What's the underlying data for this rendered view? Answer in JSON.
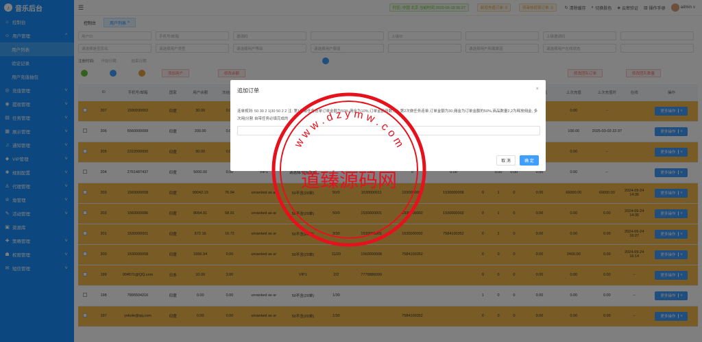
{
  "app": {
    "title": "音乐后台"
  },
  "sidebar": {
    "items": [
      {
        "label": "控制台",
        "icon": "home-icon"
      },
      {
        "label": "用户管理",
        "icon": "user-icon"
      },
      {
        "label": "充值管理",
        "icon": "recharge-icon"
      },
      {
        "label": "提现管理",
        "icon": "withdraw-icon"
      },
      {
        "label": "任务管理",
        "icon": "task-icon"
      },
      {
        "label": "展示管理",
        "icon": "display-icon"
      },
      {
        "label": "通知管理",
        "icon": "bell-icon"
      },
      {
        "label": "VIP管理",
        "icon": "vip-icon"
      },
      {
        "label": "规则配置",
        "icon": "gear-icon"
      },
      {
        "label": "代理管理",
        "icon": "agent-icon"
      },
      {
        "label": "角管理",
        "icon": "role-icon"
      },
      {
        "label": "活动管理",
        "icon": "activity-icon"
      },
      {
        "label": "资源库",
        "icon": "folder-icon"
      },
      {
        "label": "策略管理",
        "icon": "strategy-icon"
      },
      {
        "label": "权限管理",
        "icon": "lock-icon"
      },
      {
        "label": "短信管理",
        "icon": "sms-icon"
      }
    ],
    "subitems": [
      "用户列表",
      "验证记录",
      "用户充值抽包"
    ]
  },
  "header": {
    "status_time": "时区: 中国 北京 当前时间 2025-06-18 06:27",
    "order_notice": "新增充值订单: 0",
    "pending_notice": "待审核提现订单: 0",
    "links": [
      "清除缓存",
      "切换肤色",
      "云密验证",
      "操作手册"
    ],
    "user": "admin"
  },
  "tabs": [
    "控制台",
    "用户列表"
  ],
  "filters": {
    "row1": [
      "用户ID",
      "手机号/邮箱",
      "邀请码",
      "",
      "上级ID",
      "",
      "上级邀请码",
      ""
    ],
    "row2": [
      "请选择是否实名",
      "请选择用户类型",
      "请选择用户等级",
      "请选择用户渠道",
      "",
      "请选择用户所属渠道",
      "请选择用户在线状态",
      ""
    ],
    "date_label": "注册时间:",
    "date_start": "开始日期",
    "date_end": "结束日期"
  },
  "toolbar": {
    "btn1": "添加用户",
    "btn2": "修改余额",
    "btn3": "",
    "btn4": "修改团队订单",
    "btn5": "",
    "btn6": "",
    "btn7": "修改任务数量",
    "btn8": "修改团队数量"
  },
  "table": {
    "headers": [
      "",
      "ID",
      "手机号/邮箱",
      "国家",
      "用户余额",
      "冻结金额",
      "",
      "",
      "",
      "",
      "",
      "",
      "",
      "",
      "",
      "今日充值",
      "上次充值",
      "上次充值时",
      "在线",
      "操作"
    ],
    "rows": [
      {
        "hl": true,
        "c": [
          "",
          "207",
          "1590930002",
          "印度",
          "30.00",
          "0.00",
          "",
          "",
          "",
          "",
          "",
          "",
          "",
          "",
          "",
          "",
          "0.00",
          "--",
          "",
          "更多操作"
        ]
      },
      {
        "hl": false,
        "c": [
          "",
          "206",
          "5560000099",
          "印度",
          "200.00",
          "0.00",
          "",
          "",
          "",
          "",
          "",
          "",
          "",
          "",
          "",
          "",
          "100.00",
          "2025-03-03 22:37",
          "",
          "更多操作"
        ]
      },
      {
        "hl": true,
        "c": [
          "",
          "205",
          "2222000000",
          "印度",
          "50.00",
          "0.00",
          "",
          "",
          "",
          "",
          "",
          "",
          "",
          "",
          "",
          "",
          "0.00",
          "--",
          "",
          "更多操作"
        ]
      },
      {
        "hl": false,
        "c": [
          "",
          "204",
          "2761487437",
          "印度",
          "5000.00",
          "0.00",
          "VIP1",
          "请选择/包括到期",
          "",
          "0",
          "0",
          "0.00",
          "",
          "0.00",
          "0.00",
          "0.00",
          "0.00",
          "--",
          "",
          "更多操作"
        ]
      },
      {
        "hl": true,
        "c": [
          "",
          "203",
          "1560000008",
          "印度",
          "99042.19",
          "76.94",
          "unranked as ar",
          "50不含(20单)",
          "50/0",
          "1530000011",
          "1530000002",
          "1530000008",
          "0",
          "1",
          "0",
          "0.00",
          "69000.00",
          "69000.00",
          "2024-09-24 14:35",
          "更多操作"
        ]
      },
      {
        "hl": true,
        "c": [
          "",
          "202",
          "1560000086",
          "印度",
          "8064.91",
          "58.91",
          "unranked as ar",
          "50不含(20单)",
          "50/0",
          "1530000001",
          "1530000002",
          "1530000002",
          "0",
          "1",
          "0",
          "0.00",
          "0.00",
          "0.00",
          "2024-09-24 14:35",
          "更多操作"
        ]
      },
      {
        "hl": true,
        "c": [
          "",
          "201",
          "1530000001",
          "印度",
          "672.16",
          "16.72",
          "unranked as ar",
          "50不含(20单)",
          "3/30",
          "1530000001",
          "1530000002",
          "7584100352",
          "0",
          "1",
          "0",
          "0.00",
          "0.00",
          "0.00",
          "2024-09-24 16:27",
          "更多操作"
        ]
      },
      {
        "hl": true,
        "c": [
          "",
          "200",
          "1530000008",
          "印度",
          "1666.94",
          "0.00",
          "unranked as ar",
          "50不含(20单)",
          "11/20",
          "1560000008",
          "7584100352",
          "",
          "0",
          "0",
          "0",
          "0.00",
          "2400.00",
          "0.00",
          "2024-09-24 16:14",
          "更多操作"
        ]
      },
      {
        "hl": true,
        "c": [
          "",
          "199",
          "904571@QQ.com",
          "日本",
          "10.00",
          "3.00",
          "",
          "VIP1",
          "2/2",
          "7776886099",
          "",
          "",
          "0",
          "0",
          "0",
          "0.00",
          "0.00",
          "0.00",
          "--",
          "更多操作"
        ]
      },
      {
        "hl": false,
        "c": [
          "",
          "198",
          "7895504216",
          "印度",
          "0.00",
          "0.00",
          "unranked as ar",
          "50不含(20单)",
          "1/30",
          "",
          "",
          "",
          "1",
          "0",
          "0",
          "0.00",
          "0.00",
          "0.00",
          "--",
          "更多操作"
        ]
      },
      {
        "hl": true,
        "c": [
          "",
          "197",
          "yokole@qq.com",
          "印度",
          "0.00",
          "0.00",
          "unranked as ar",
          "50不含(20单)",
          "1/30",
          "",
          "7584100352",
          "",
          "0",
          "0",
          "0",
          "0.00",
          "0.00",
          "0.00",
          "--",
          "更多操作"
        ]
      }
    ]
  },
  "dialog": {
    "title": "追加订单",
    "message": "连单规则: 50 30 2 1|30 50 2 2 注: 第1次做任务连单订单金额为50%,佣金为10%,订单金额倍数为2; 第2次做任务连单,订单金额为30,佣金为订单金额的50%,商品数量2,2为释放佣金, 多次用|分割 自带任务必填完成的",
    "cancel": "取 消",
    "confirm": "确 定"
  },
  "watermark": {
    "top_text": "w w w . d z y m w . c o m",
    "center_text": "道臻源码网",
    "color": "#e5121d"
  }
}
